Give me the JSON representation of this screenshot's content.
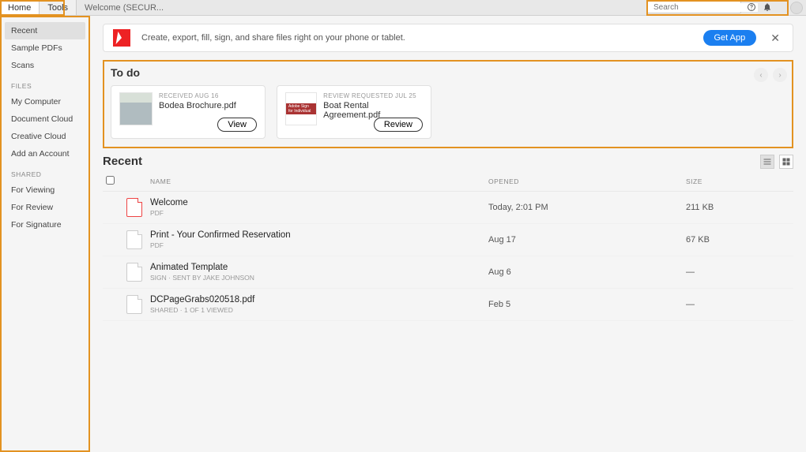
{
  "topbar": {
    "tabs": [
      "Home",
      "Tools"
    ],
    "doc_title": "Welcome (SECUR...",
    "search_placeholder": "Search"
  },
  "sidebar": {
    "primary": [
      "Recent",
      "Sample PDFs",
      "Scans"
    ],
    "files_heading": "FILES",
    "files": [
      "My Computer",
      "Document Cloud",
      "Creative Cloud",
      "Add an Account"
    ],
    "shared_heading": "SHARED",
    "shared": [
      "For Viewing",
      "For Review",
      "For Signature"
    ]
  },
  "banner": {
    "text": "Create, export, fill, sign, and share files right on your phone or tablet.",
    "cta": "Get App"
  },
  "todo": {
    "title": "To do",
    "cards": [
      {
        "meta": "RECEIVED AUG 16",
        "name": "Bodea Brochure.pdf",
        "btn": "View"
      },
      {
        "meta": "REVIEW REQUESTED JUL 25",
        "name": "Boat Rental Agreement.pdf",
        "btn": "Review"
      }
    ]
  },
  "recent": {
    "title": "Recent",
    "columns": {
      "name": "NAME",
      "opened": "OPENED",
      "size": "SIZE"
    },
    "rows": [
      {
        "name": "Welcome",
        "sub": "PDF",
        "opened": "Today, 2:01 PM",
        "size": "211 KB",
        "icon": "pdf"
      },
      {
        "name": "Print - Your Confirmed Reservation",
        "sub": "PDF",
        "opened": "Aug 17",
        "size": "67 KB",
        "icon": "doc"
      },
      {
        "name": "Animated Template",
        "sub": "SIGN  ·  Sent by Jake Johnson",
        "opened": "Aug 6",
        "size": "—",
        "icon": "sign"
      },
      {
        "name": "DCPageGrabs020518.pdf",
        "sub": "SHARED  ·  1 of 1 viewed",
        "opened": "Feb 5",
        "size": "—",
        "icon": "shared"
      }
    ]
  }
}
